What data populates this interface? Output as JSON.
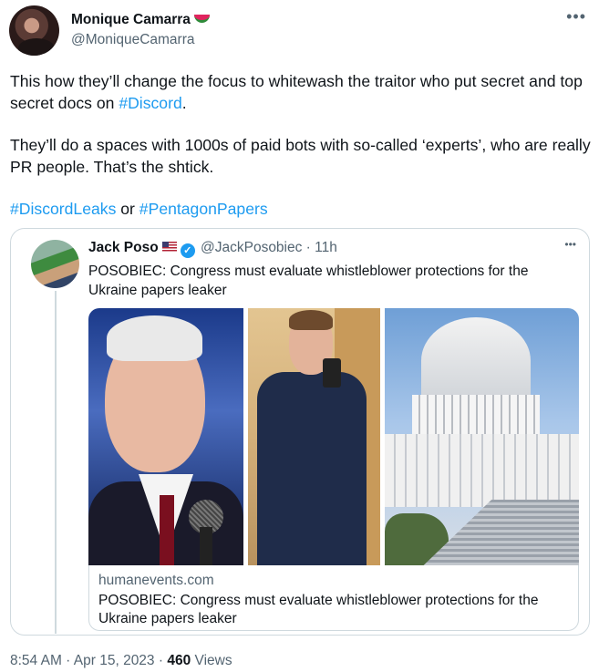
{
  "tweet": {
    "author_name": "Monique Camarra",
    "author_handle": "@MoniqueCamarra",
    "author_emoji_icon": "watermelon-icon",
    "more_icon": "more-horizontal-icon",
    "text_p1_before": "This how they’ll change the focus to whitewash the traitor who put secret and top secret docs on ",
    "text_p1_hashtag": "#Discord",
    "text_p1_after": ".",
    "text_p2": "They’ll do a spaces with 1000s of paid bots with so-called ‘experts’, who are really PR people. That’s the shtick.",
    "hashtag_1": "#DiscordLeaks",
    "text_or": " or ",
    "hashtag_2": "#PentagonPapers",
    "time": "8:54 AM · Apr 15, 2023 · ",
    "views_count": "460",
    "views_label": " Views"
  },
  "quote": {
    "author_name": "Jack Poso",
    "flag_icon": "us-flag-icon",
    "verified_icon": "verified-badge-icon",
    "handle_time": "@JackPosobiec · 11h",
    "text": "POSOBIEC: Congress must evaluate whistleblower protections for the Ukraine papers leaker",
    "link_domain": "humanevents.com",
    "link_title": "POSOBIEC: Congress must evaluate whistleblower protections for the Ukraine papers leaker"
  },
  "colors": {
    "link_blue": "#1d9bf0",
    "secondary_text": "#536471",
    "border": "#cfd9de"
  }
}
